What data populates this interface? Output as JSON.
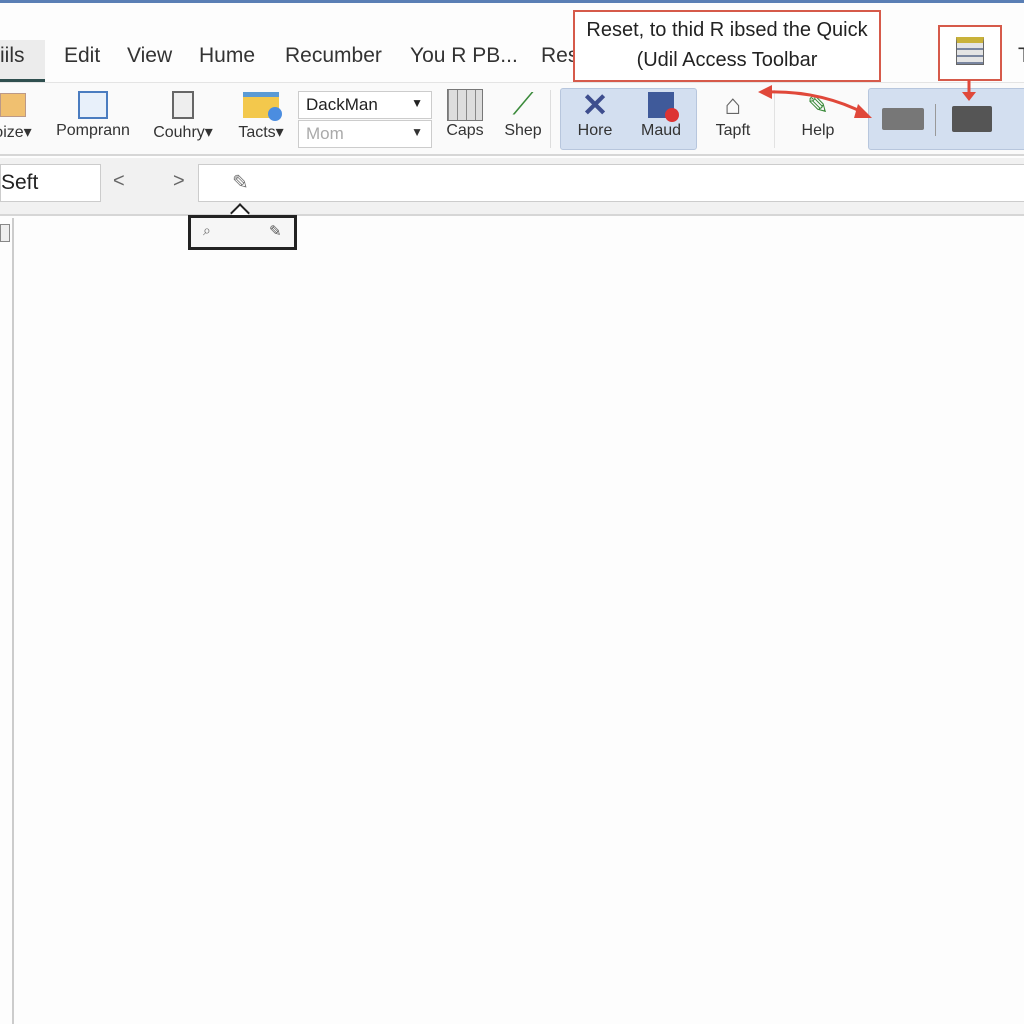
{
  "menu": {
    "items": [
      "iils",
      "Edit",
      "View",
      "Hume",
      "Recumber",
      "You R PB...",
      "Res",
      "T"
    ]
  },
  "ribbon": {
    "buttons": [
      {
        "label": "oize",
        "icon": "picture-icon"
      },
      {
        "label": "Pomprann",
        "icon": "window-icon"
      },
      {
        "label": "Couhry",
        "icon": "document-icon"
      },
      {
        "label": "Tacts",
        "icon": "folder-icon"
      },
      {
        "label": "Caps",
        "icon": "grid-icon"
      },
      {
        "label": "Shep",
        "icon": "pen-icon"
      },
      {
        "label": "Hore",
        "icon": "close-x-icon"
      },
      {
        "label": "Maud",
        "icon": "window-badge-icon"
      },
      {
        "label": "Tapft",
        "icon": "home-icon"
      },
      {
        "label": "Help",
        "icon": "pencil-icon"
      }
    ],
    "font_dropdown": "DackMan",
    "size_dropdown": "Mom"
  },
  "formula_bar": {
    "name_box": "Seft",
    "prev": "<",
    "next": ">"
  },
  "callout": {
    "line1": "Reset, to thid R ibsed the Quick",
    "line2": "(Udil Access Toolbar"
  },
  "colors": {
    "accent": "#d65a4a",
    "highlight": "#d3dff0"
  }
}
